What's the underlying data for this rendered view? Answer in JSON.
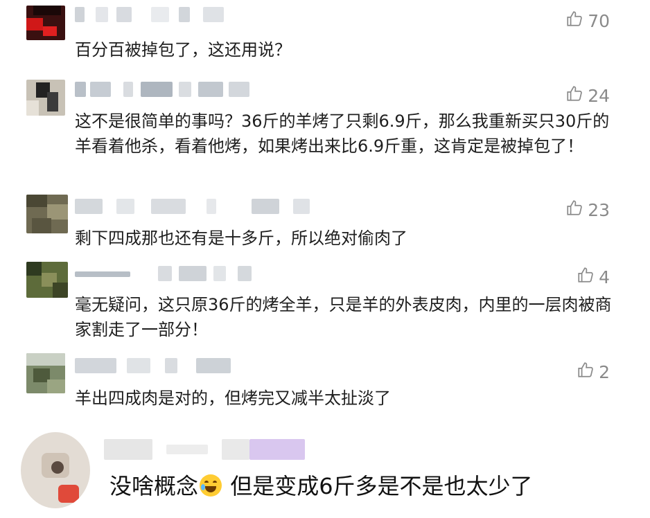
{
  "comments": [
    {
      "text": "百分百被掉包了，这还用说？",
      "likes": "70"
    },
    {
      "text": "这不是很简单的事吗？36斤的羊烤了只剩6.9斤，那么我重新买只30斤的羊看着他杀，看着他烤，如果烤出来比6.9斤重，这肯定是被掉包了！",
      "likes": "24"
    },
    {
      "text": "剩下四成那也还有是十多斤，所以绝对偷肉了",
      "likes": "23"
    },
    {
      "text": "毫无疑问，这只原36斤的烤全羊，只是羊的外表皮肉，内里的一层肉被商家割走了一部分！",
      "likes": "4"
    },
    {
      "text": "羊出四成肉是对的，但烤完又减半太扯淡了",
      "likes": "2"
    }
  ],
  "last_comment": {
    "text_before": "没啥概念",
    "emoji": "laughing-tears-emoji",
    "text_after": " 但是变成6斤多是不是也太少了"
  },
  "icons": {
    "like": "thumbs-up-icon"
  },
  "colors": {
    "like": "#8a8a8a",
    "text": "#1e1e1e"
  }
}
